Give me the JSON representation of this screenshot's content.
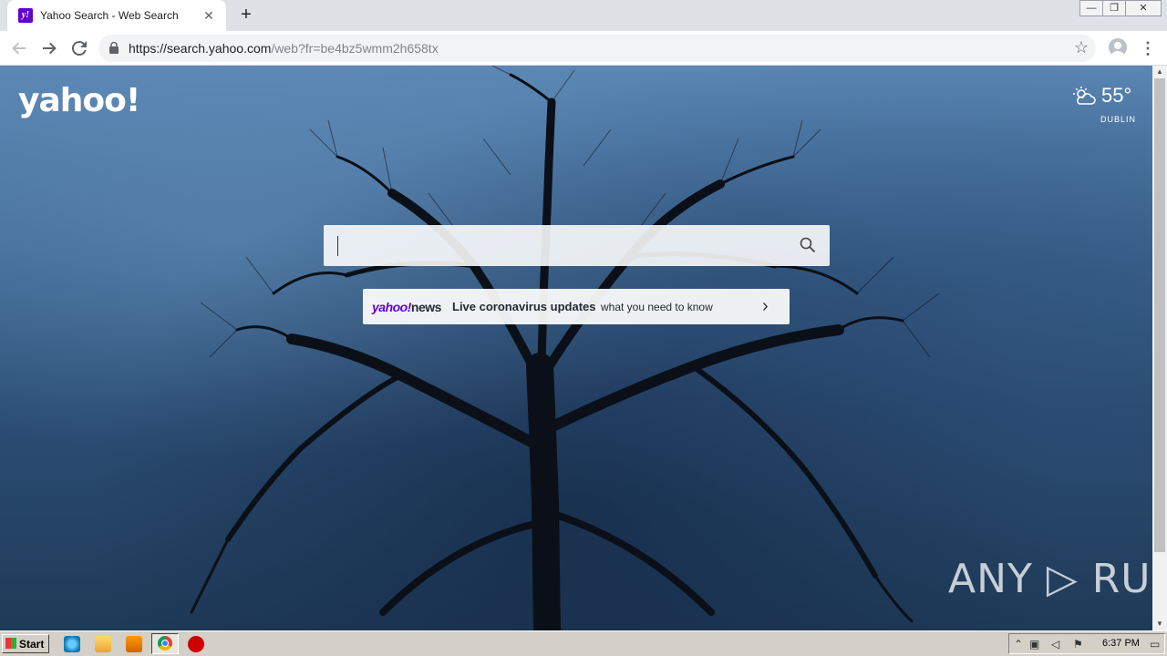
{
  "browser": {
    "tab_title": "Yahoo Search - Web Search",
    "favicon_text": "y!",
    "tab_close": "✕",
    "new_tab": "+",
    "url_host": "https://search.yahoo.com",
    "url_path": "/web?fr=be4bz5wmm2h658tx",
    "window_controls": [
      "—",
      "❐",
      "✕"
    ]
  },
  "page": {
    "logo": "yahoo!",
    "weather": {
      "temp": "55°",
      "city": "DUBLIN",
      "icon": "partly-cloudy-icon"
    },
    "search": {
      "placeholder": ""
    },
    "news": {
      "brand_yahoo": "yahoo!",
      "brand_news": "news",
      "headline": "Live coronavirus updates",
      "subtext": "what you need to know"
    },
    "watermark": "ANY ▷ RUN"
  },
  "taskbar": {
    "start_label": "Start",
    "clock": "6:37 PM"
  },
  "colors": {
    "yahoo_purple": "#6001d2",
    "tabstrip": "#dee1e6",
    "taskbar": "#d4d0c8"
  }
}
